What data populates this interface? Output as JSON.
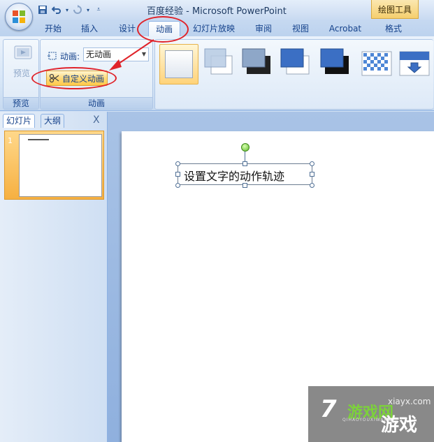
{
  "window": {
    "title": "百度经验 - Microsoft PowerPoint",
    "context_tool": "绘图工具"
  },
  "qat": {
    "save_icon": "save-icon",
    "undo_icon": "undo-icon",
    "redo_icon": "redo-icon"
  },
  "tabs": [
    {
      "label": "开始"
    },
    {
      "label": "插入"
    },
    {
      "label": "设计"
    },
    {
      "label": "动画",
      "active": true
    },
    {
      "label": "幻灯片放映"
    },
    {
      "label": "审阅"
    },
    {
      "label": "视图"
    },
    {
      "label": "Acrobat"
    },
    {
      "label": "格式"
    }
  ],
  "ribbon": {
    "preview_group": {
      "button": "预览",
      "label": "预览"
    },
    "animation_group": {
      "animation_label": "动画:",
      "animation_value": "无动画",
      "custom_button": "自定义动画",
      "label": "动画"
    }
  },
  "leftpane": {
    "tab_slides": "幻灯片",
    "tab_outline": "大纲",
    "close": "X",
    "slide_number": "1"
  },
  "slide": {
    "textbox_text": "设置文字的动作轨迹"
  },
  "watermark": {
    "site": "xiayx.com",
    "digit": "7",
    "brand_top": "游戏网",
    "brand_bottom": "游戏",
    "pinyin": "QIHAOYOUXIWANG"
  },
  "colors": {
    "annotation": "#e0232a",
    "active_gallery": "#ffd37a",
    "ribbon_text": "#15428b"
  }
}
